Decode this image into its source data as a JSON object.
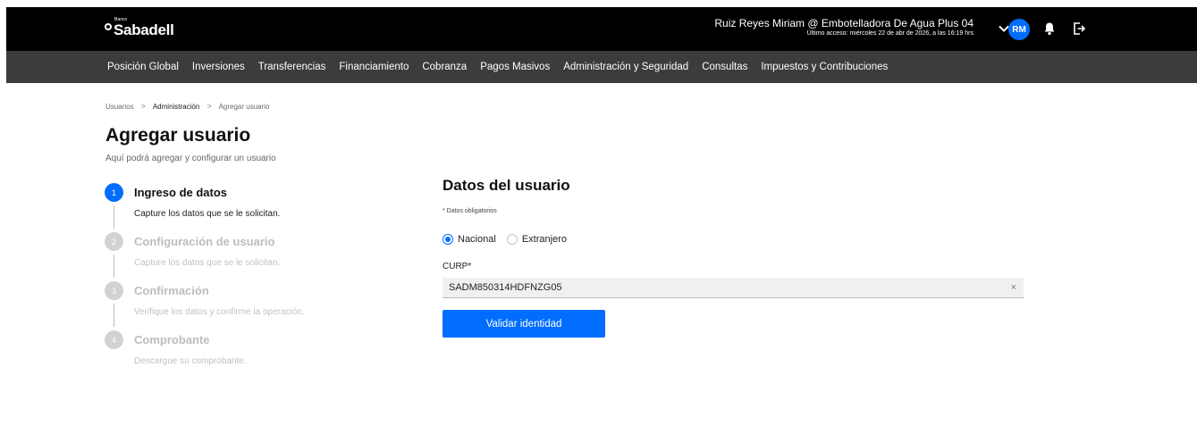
{
  "header": {
    "logo_small": "Banco",
    "logo_name": "Sabadell",
    "user_name": "Ruiz Reyes Miriam @ Embotelladora De Agua Plus 04",
    "last_access": "Último acceso: miércoles 22 de abr de 2026, a las 16:19 hrs",
    "avatar_initials": "RM",
    "icons": {
      "menu": "chevron-down-icon",
      "notifications": "bell-icon",
      "logout": "logout-icon"
    },
    "accent_color": "#006dff"
  },
  "nav": {
    "items": [
      {
        "label": "Posición Global"
      },
      {
        "label": "Inversiones"
      },
      {
        "label": "Transferencias"
      },
      {
        "label": "Financiamiento"
      },
      {
        "label": "Cobranza"
      },
      {
        "label": "Pagos Masivos"
      },
      {
        "label": "Administración y Seguridad"
      },
      {
        "label": "Consultas"
      },
      {
        "label": "Impuestos y Contribuciones"
      }
    ]
  },
  "breadcrumb": {
    "items": [
      {
        "label": "Usuarios"
      },
      {
        "label": "Administración"
      },
      {
        "label": "Agregar usuario"
      }
    ],
    "separator": ">"
  },
  "page": {
    "title": "Agregar usuario",
    "subtitle": "Aquí podrá agregar y configurar un usuario"
  },
  "stepper": {
    "steps": [
      {
        "number": "1",
        "title": "Ingreso de datos",
        "description": "Capture los datos que se le solicitan.",
        "state": "active"
      },
      {
        "number": "2",
        "title": "Configuración de usuario",
        "description": "Capture los datos que se le solicitan.",
        "state": "inactive"
      },
      {
        "number": "3",
        "title": "Confirmación",
        "description": "Verifique los datos y confirme la operación.",
        "state": "inactive"
      },
      {
        "number": "4",
        "title": "Comprobante",
        "description": "Descargue su comprobante.",
        "state": "inactive"
      }
    ]
  },
  "form": {
    "title": "Datos del usuario",
    "required_note": "* Datos obligatorios",
    "radio_options": [
      {
        "label": "Nacional",
        "checked": true
      },
      {
        "label": "Extranjero",
        "checked": false
      }
    ],
    "curp_label": "CURP*",
    "curp_value": "SADM850314HDFNZG05",
    "clear_symbol": "×",
    "validate_button": "Validar identidad"
  }
}
